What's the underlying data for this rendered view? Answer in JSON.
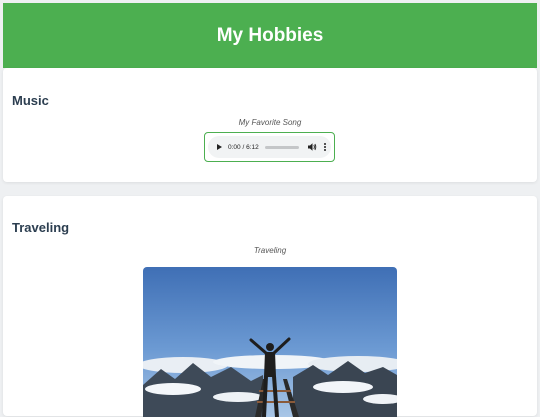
{
  "header": {
    "title": "My Hobbies"
  },
  "music": {
    "heading": "Music",
    "caption": "My Favorite Song",
    "player": {
      "time": "0:00 / 6:12",
      "progress": 0
    }
  },
  "travel": {
    "heading": "Traveling",
    "caption": "Traveling",
    "image_alt": "Person with raised arms on a mountain summit above clouds"
  },
  "colors": {
    "accent": "#4caf50",
    "heading": "#2c3e50",
    "background": "#eef0f2"
  }
}
